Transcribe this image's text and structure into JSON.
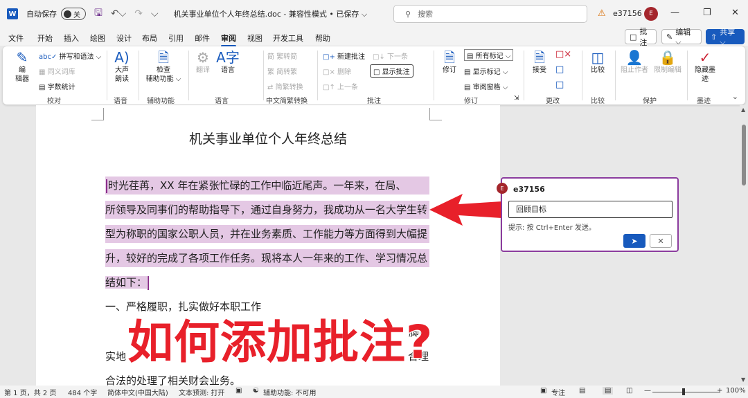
{
  "titlebar": {
    "app_icon": "W",
    "autosave_label": "自动保存",
    "autosave_state": "关",
    "doc_title": "机关事业单位个人年终总结.doc  -  兼容性模式 • 已保存 ⌵",
    "search_placeholder": "搜索",
    "user": "e37156",
    "avatar_initial": "E"
  },
  "menu": {
    "tabs": [
      "文件",
      "开始",
      "插入",
      "绘图",
      "设计",
      "布局",
      "引用",
      "邮件",
      "审阅",
      "视图",
      "开发工具",
      "帮助"
    ],
    "comment_btn": "批注",
    "edit_btn": "编辑 ⌵",
    "share_btn": "共享 ⌵"
  },
  "ribbon": {
    "editor_1": "编",
    "editor_2": "辑器",
    "spelling": "拼写和语法 ⌵",
    "thesaurus": "同义词库",
    "word_count": "字数统计",
    "proofing_label": "校对",
    "read_aloud_1": "大声",
    "read_aloud_2": "朗读",
    "speech_label": "语音",
    "check_access_1": "检查",
    "check_access_2": "辅助功能 ⌵",
    "access_label": "辅助功能",
    "translate": "翻译",
    "language": "语言",
    "language_label": "语言",
    "trad_to_simp": "繁转简",
    "simp_to_trad": "简转繁",
    "simp_trad_convert": "简繁转换",
    "chinese_convert_label": "中文简繁转换",
    "new_comment": "新建批注",
    "delete": "删除",
    "previous": "上一条",
    "next": "下一条",
    "show_comments": "显示批注",
    "comments_label": "批注",
    "track_changes": "修订",
    "all_markup": "所有标记",
    "show_markup": "显示标记 ⌵",
    "review_pane": "审阅窗格",
    "tracking_label": "修订",
    "accept": "接受",
    "changes_label": "更改",
    "compare": "比较",
    "compare_label": "比较",
    "block_authors": "阻止作者",
    "restrict_editing": "限制编辑",
    "protect_label": "保护",
    "hide_ink_1": "隐藏墨",
    "hide_ink_2": "迹",
    "ink_label": "墨迹"
  },
  "document": {
    "heading": "机关事业单位个人年终总结",
    "lines": [
      "时光荏苒，XX 年在紧张忙碌的工作中临近尾声。一年来，在局、",
      "所领导及同事们的帮助指导下，通过自身努力，我成功从一名大学生转",
      "型为称职的国家公职人员，并在业务素质、工作能力等方面得到大幅提",
      "升，较好的完成了各项工作任务。现将本人一年来的工作、学习情况总",
      "结如下："
    ],
    "section_1": "一、严格履职，扎实做好本职工作",
    "line_partial_right": "脚踏",
    "line_partial_left_2": "实地",
    "line_partial_right_2": "，合理",
    "line_last": "合法的处理了相关财会业务。"
  },
  "overlay": {
    "text": "如何添加批注?"
  },
  "comment": {
    "avatar_initial": "E",
    "author": "e37156",
    "input_value": "回顾目标",
    "hint": "提示: 按 Ctrl+Enter 发送。",
    "send_icon": "send-icon",
    "cancel_icon": "close-icon"
  },
  "statusbar": {
    "page": "第 1 页，共 2 页",
    "words": "484 个字",
    "language": "简体中文(中国大陆)",
    "text_prediction": "文本预测: 打开",
    "accessibility": "辅助功能: 不可用",
    "focus": "专注",
    "zoom": "100%"
  },
  "colors": {
    "accent": "#185abd",
    "highlight": "#e4c8e4",
    "comment_border": "#8b3c9e",
    "overlay_red": "#e8202a",
    "arrow_red": "#e8202a",
    "avatar": "#a4262c"
  }
}
